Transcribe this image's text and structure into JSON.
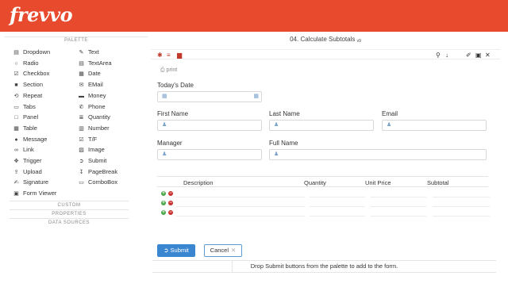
{
  "app": {
    "logo": "frevvo",
    "colors": {
      "header": "#e84a2e",
      "primary": "#3b86d0"
    }
  },
  "palette": {
    "title": "PALETTE",
    "items": [
      {
        "label": "Dropdown",
        "icon": "list-icon",
        "glyph": "▤"
      },
      {
        "label": "Radio",
        "icon": "radio-icon",
        "glyph": "○"
      },
      {
        "label": "Checkbox",
        "icon": "checkbox-icon",
        "glyph": "☑"
      },
      {
        "label": "Section",
        "icon": "folder-icon",
        "glyph": "■"
      },
      {
        "label": "Repeat",
        "icon": "repeat-icon",
        "glyph": "⟲"
      },
      {
        "label": "Tabs",
        "icon": "tabs-icon",
        "glyph": "▭"
      },
      {
        "label": "Panel",
        "icon": "panel-icon",
        "glyph": "□"
      },
      {
        "label": "Table",
        "icon": "table-icon",
        "glyph": "▦"
      },
      {
        "label": "Message",
        "icon": "message-icon",
        "glyph": "●"
      },
      {
        "label": "Link",
        "icon": "link-icon",
        "glyph": "∞"
      },
      {
        "label": "Trigger",
        "icon": "trigger-icon",
        "glyph": "✥"
      },
      {
        "label": "Upload",
        "icon": "upload-icon",
        "glyph": "⇪"
      },
      {
        "label": "Signature",
        "icon": "signature-icon",
        "glyph": "✍"
      },
      {
        "label": "Form Viewer",
        "icon": "form-viewer-icon",
        "glyph": "▣"
      },
      {
        "label": "Text",
        "icon": "pencil-icon",
        "glyph": "✎"
      },
      {
        "label": "TextArea",
        "icon": "textarea-icon",
        "glyph": "▤"
      },
      {
        "label": "Date",
        "icon": "calendar-icon",
        "glyph": "▦"
      },
      {
        "label": "EMail",
        "icon": "email-icon",
        "glyph": "✉"
      },
      {
        "label": "Money",
        "icon": "money-icon",
        "glyph": "▬"
      },
      {
        "label": "Phone",
        "icon": "phone-icon",
        "glyph": "✆"
      },
      {
        "label": "Quantity",
        "icon": "quantity-icon",
        "glyph": "≣"
      },
      {
        "label": "Number",
        "icon": "number-icon",
        "glyph": "▥"
      },
      {
        "label": "T/F",
        "icon": "true-false-icon",
        "glyph": "☑"
      },
      {
        "label": "Image",
        "icon": "image-icon",
        "glyph": "▨"
      },
      {
        "label": "Submit",
        "icon": "submit-icon",
        "glyph": "➲"
      },
      {
        "label": "PageBreak",
        "icon": "pagebreak-icon",
        "glyph": "↧"
      },
      {
        "label": "ComboBox",
        "icon": "combobox-icon",
        "glyph": "▭"
      }
    ],
    "sections": [
      "CUSTOM",
      "PROPERTIES",
      "DATA SOURCES"
    ]
  },
  "form": {
    "title": "04. Calculate Subtotals",
    "version": "v9",
    "print_label": "print",
    "todays_date": {
      "label": "Today's Date"
    },
    "first_name": {
      "label": "First Name"
    },
    "last_name": {
      "label": "Last Name"
    },
    "email": {
      "label": "Email"
    },
    "manager": {
      "label": "Manager"
    },
    "full_name": {
      "label": "Full Name"
    },
    "table": {
      "headers": [
        "Description",
        "Quantity",
        "Unit Price",
        "Subtotal"
      ],
      "row_count": 3
    },
    "submit_label": "Submit",
    "cancel_label": "Cancel",
    "drop_hint": "Drop Submit buttons from the palette to add to the form."
  }
}
